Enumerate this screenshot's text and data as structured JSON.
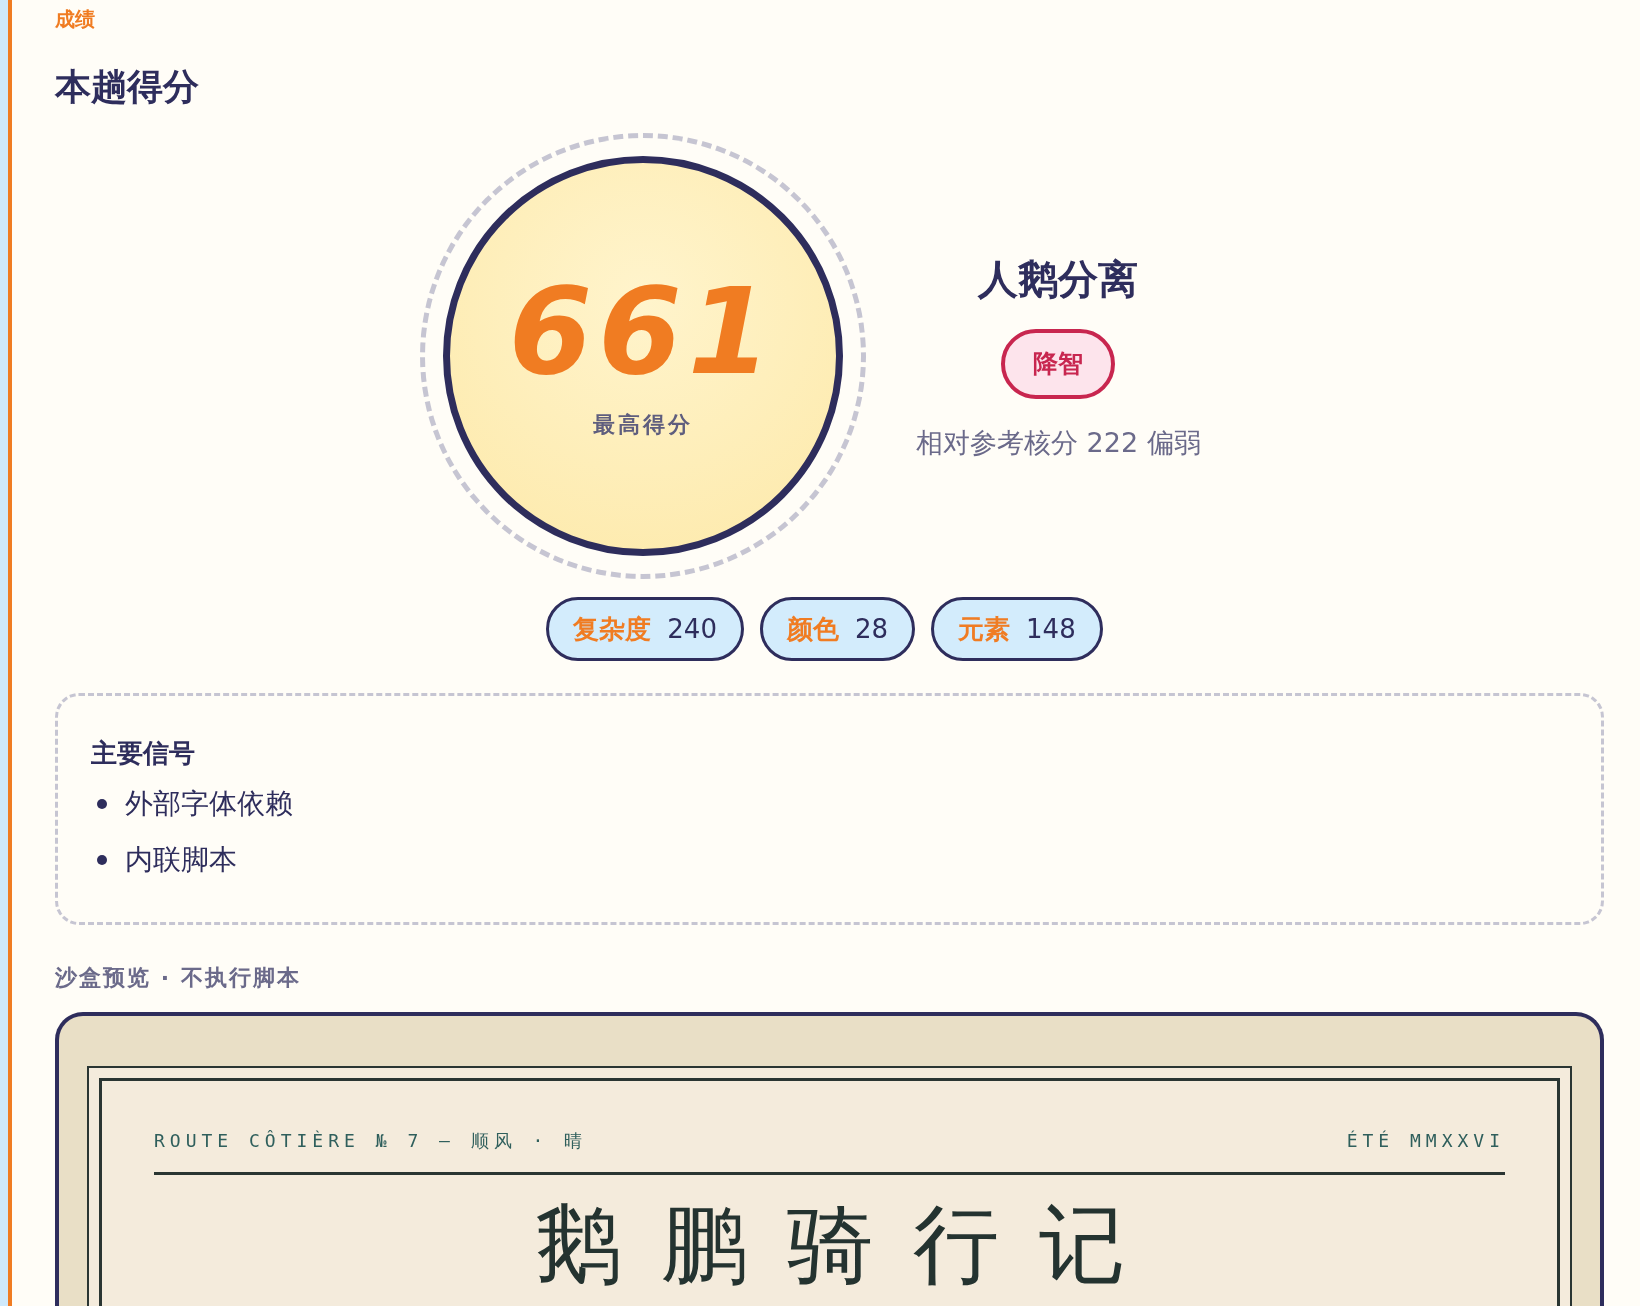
{
  "section_label": "成绩",
  "title": "本趟得分",
  "score": {
    "value": "661",
    "caption": "最高得分"
  },
  "verdict": {
    "name": "人鹅分离",
    "badge": "降智",
    "note": "相对参考核分 222 偏弱"
  },
  "metrics": [
    {
      "label": "复杂度",
      "value": "240"
    },
    {
      "label": "颜色",
      "value": "28"
    },
    {
      "label": "元素",
      "value": "148"
    }
  ],
  "signals": {
    "title": "主要信号",
    "items": [
      "外部字体依赖",
      "内联脚本"
    ]
  },
  "preview": {
    "label": "沙盒预览 · 不执行脚本",
    "header_left": "ROUTE CÔTIÈRE № 7 — 顺风 · 晴",
    "header_right": "ÉTÉ MMXXVI",
    "title": "鹅鹏骑行记"
  }
}
